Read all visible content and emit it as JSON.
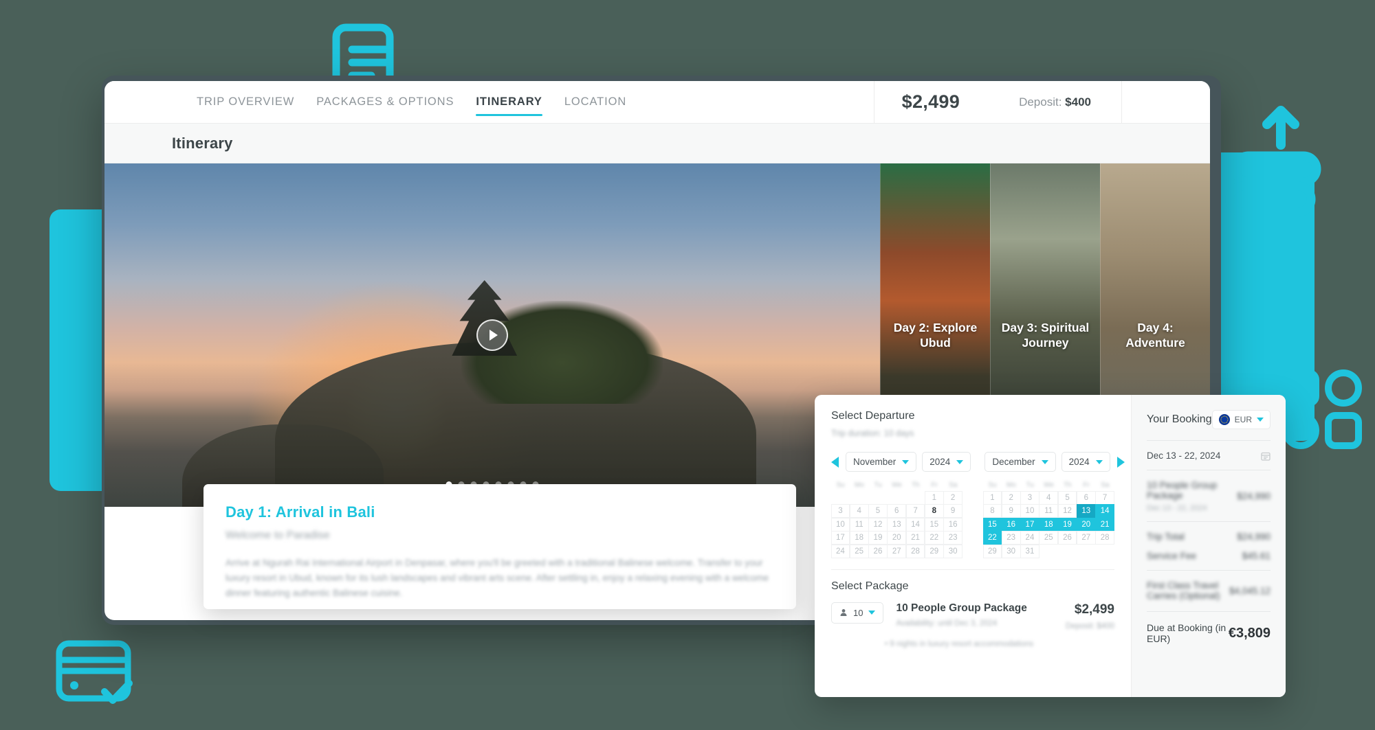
{
  "tabs": [
    {
      "label": "TRIP OVERVIEW",
      "active": false
    },
    {
      "label": "PACKAGES & OPTIONS",
      "active": false
    },
    {
      "label": "ITINERARY",
      "active": true
    },
    {
      "label": "LOCATION",
      "active": false
    }
  ],
  "header": {
    "price": "$2,499",
    "deposit_label": "Deposit:",
    "deposit_value": "$400",
    "page_title": "Itinerary"
  },
  "hero": {
    "play_icon": "play-icon",
    "dots_total": 8,
    "dots_active_index": 0,
    "day_cards": [
      {
        "label": "Day 2: Explore Ubud"
      },
      {
        "label": "Day 3: Spiritual Journey"
      },
      {
        "label": "Day 4: Adventure"
      }
    ]
  },
  "day1": {
    "title": "Day 1: Arrival in Bali",
    "subtitle": "Welcome to Paradise",
    "body": "Arrive at Ngurah Rai International Airport in Denpasar, where you'll be greeted with a traditional Balinese welcome. Transfer to your luxury resort in Ubud, known for its lush landscapes and vibrant arts scene. After settling in, enjoy a relaxing evening with a welcome dinner featuring authentic Balinese cuisine."
  },
  "booking": {
    "departure": {
      "title": "Select Departure",
      "subtitle": "Trip duration: 10 days",
      "prev_icon": "chevron-left-icon",
      "next_icon": "chevron-right-icon",
      "calendars": [
        {
          "month": "November",
          "year": "2024",
          "weekdays": [
            "Su",
            "Mo",
            "Tu",
            "We",
            "Th",
            "Fr",
            "Sa"
          ],
          "lead_blanks": 5,
          "days": 30,
          "today": 8,
          "selected": []
        },
        {
          "month": "December",
          "year": "2024",
          "weekdays": [
            "Su",
            "Mo",
            "Tu",
            "We",
            "Th",
            "Fr",
            "Sa"
          ],
          "lead_blanks": 0,
          "days": 31,
          "today": 0,
          "selected": [
            13,
            14,
            15,
            16,
            17,
            18,
            19,
            20,
            21,
            22
          ],
          "range_start": 13
        }
      ]
    },
    "package": {
      "title": "Select Package",
      "people_icon": "person-icon",
      "people_count": "10",
      "name": "10 People Group Package",
      "price": "$2,499",
      "availability": "Availability: until Dec 3, 2024",
      "deposit": "Deposit: $400",
      "bullet": "• 9 nights in luxury resort accommodations"
    },
    "summary": {
      "title": "Your Booking",
      "currency_icon": "eu-flag-icon",
      "currency": "EUR",
      "date_range": "Dec 13 - 22, 2024",
      "date_icon": "calendar-icon",
      "rows": [
        {
          "label": "10 People Group Package",
          "sub": "Dec 13 - 22, 2024",
          "value": "$24,990",
          "blurred": true
        },
        {
          "label": "Trip Total",
          "sub": "",
          "value": "$24,990",
          "blurred": true
        },
        {
          "label": "Service Fee",
          "sub": "",
          "value": "$45.61",
          "blurred": true
        },
        {
          "label": "First Class Travel Carries (Optional)",
          "sub": "",
          "value": "$4,045.12",
          "blurred": true
        }
      ],
      "total_label": "Due at Booking (in EUR)",
      "total_value": "€3,809"
    }
  },
  "decor": {
    "doc_icon": "document-lines-icon",
    "upload_icon": "upload-arrow-icon",
    "card_icon": "credit-card-check-icon",
    "shapes_icon": "shapes-category-icon",
    "accent_color": "#1fc4dd",
    "background_color": "#4a6059"
  }
}
